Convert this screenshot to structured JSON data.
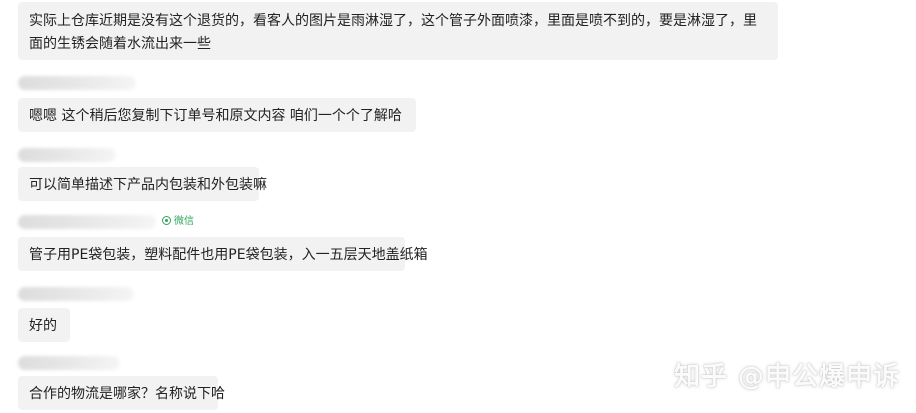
{
  "messages": [
    {
      "text": "实际上仓库近期是没有这个退货的，看客人的图片是雨淋湿了，这个管子外面喷漆，里面是喷不到的，要是淋湿了，里面的生锈会随着水流出来一些"
    },
    {
      "text": "嗯嗯  这个稍后您复制下订单号和原文内容     咱们一个个了解哈"
    },
    {
      "text": "可以简单描述下产品内包装和外包装嘛"
    },
    {
      "text": "管子用PE袋包装，塑料配件也用PE袋包装，入一五层天地盖纸箱"
    },
    {
      "text": "好的"
    },
    {
      "text": "合作的物流是哪家？名称说下哈"
    }
  ],
  "source_tag": "微信",
  "watermark": "知乎 @申公爆申诉"
}
